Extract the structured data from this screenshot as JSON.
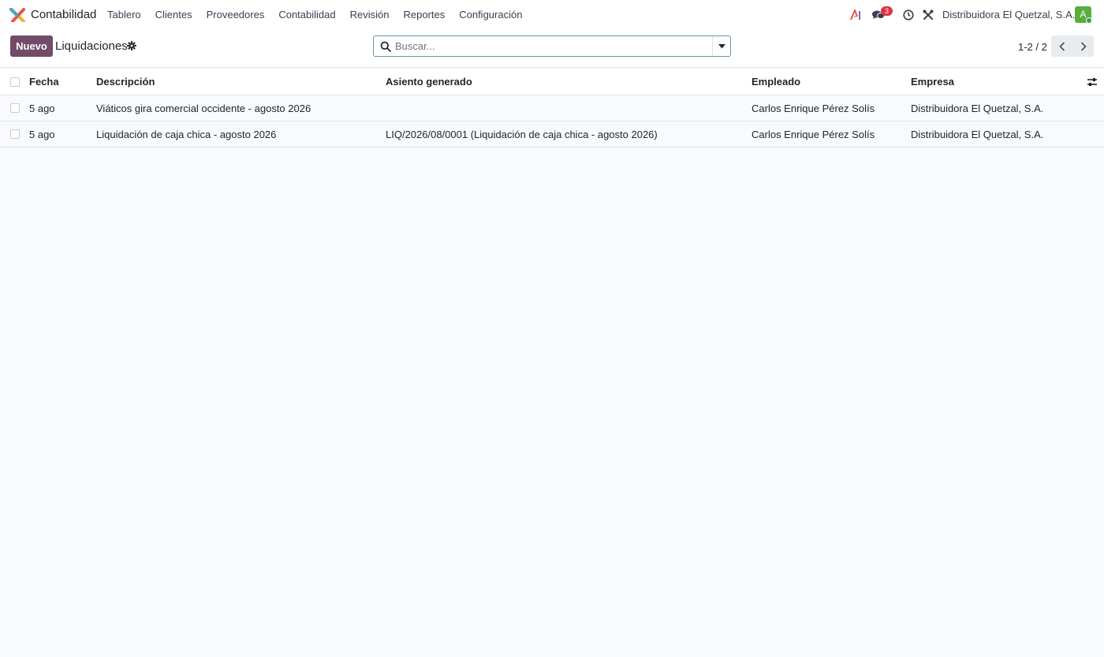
{
  "app": {
    "name": "Contabilidad",
    "logo_icon": "odoo-accounting-logo"
  },
  "menu": [
    {
      "label": "Tablero"
    },
    {
      "label": "Clientes"
    },
    {
      "label": "Proveedores"
    },
    {
      "label": "Contabilidad"
    },
    {
      "label": "Revisión"
    },
    {
      "label": "Reportes"
    },
    {
      "label": "Configuración"
    }
  ],
  "systray": {
    "messages_badge": "3",
    "company": "Distribuidora El Quetzal, S.A.",
    "avatar_letter": "A",
    "icons": [
      "ai-icon",
      "chat-icon",
      "clock-icon",
      "tools-icon"
    ]
  },
  "control": {
    "new_label": "Nuevo",
    "breadcrumb": "Liquidaciones",
    "search_placeholder": "Buscar...",
    "pager": "1-2 / 2"
  },
  "table": {
    "columns": [
      "Fecha",
      "Descripción",
      "Asiento generado",
      "Empleado",
      "Empresa"
    ],
    "rows": [
      {
        "fecha": "5 ago",
        "descripcion": "Viáticos gira comercial occidente - agosto 2026",
        "asiento": "",
        "empleado": "Carlos Enrique Pérez Solís",
        "empresa": "Distribuidora El Quetzal, S.A."
      },
      {
        "fecha": "5 ago",
        "descripcion": "Liquidación de caja chica - agosto 2026",
        "asiento": "LIQ/2026/08/0001 (Liquidación de caja chica - agosto 2026)",
        "empleado": "Carlos Enrique Pérez Solís",
        "empresa": "Distribuidora El Quetzal, S.A."
      }
    ]
  },
  "colors": {
    "primary": "#714b67",
    "avatar": "#5cad3b",
    "badge": "#dc3545"
  }
}
